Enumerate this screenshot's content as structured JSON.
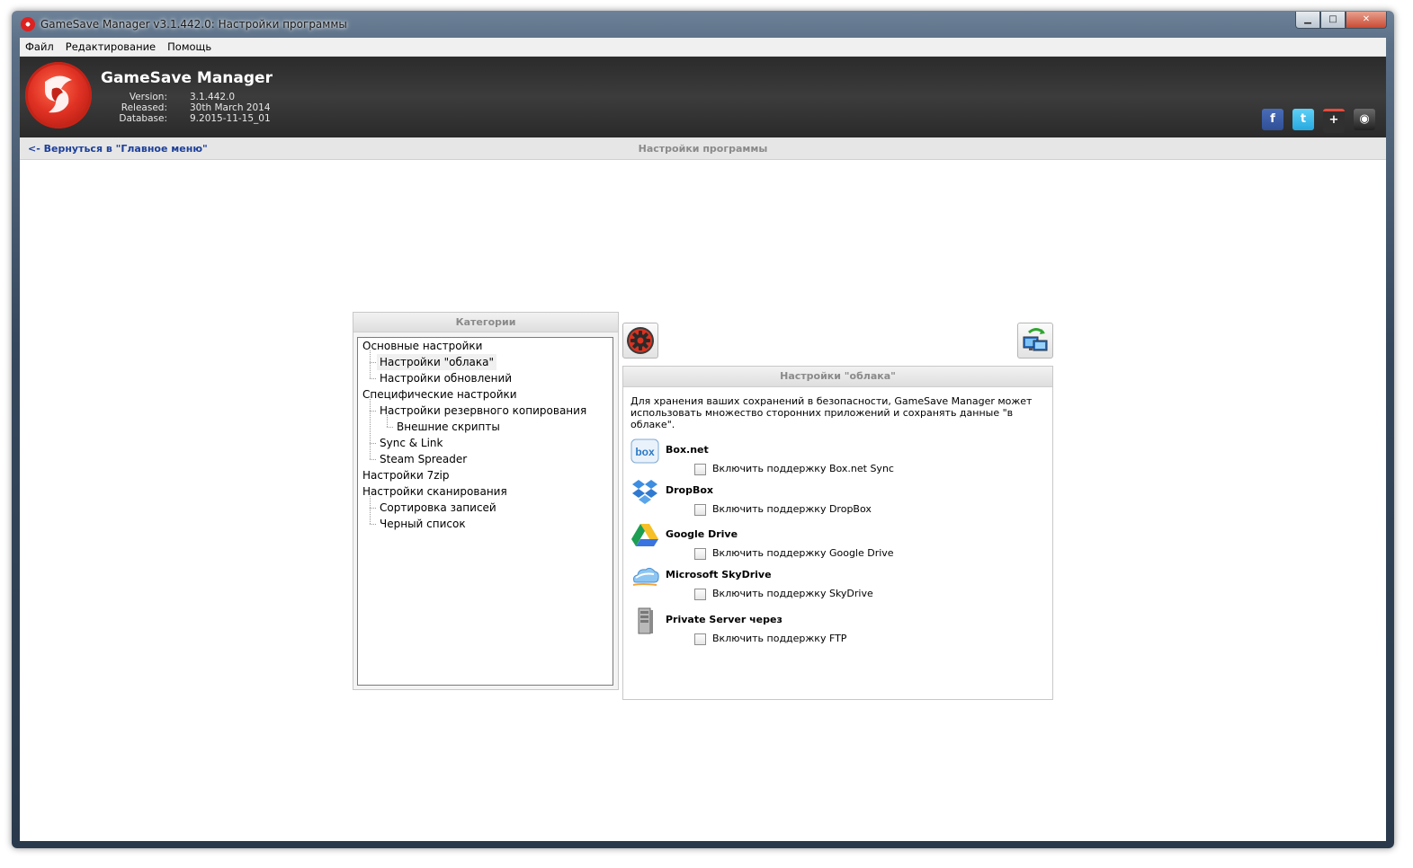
{
  "window": {
    "title": "GameSave Manager v3.1.442.0: Настройки программы",
    "minimize": "▁",
    "maximize": "□",
    "close": "✕"
  },
  "menu": [
    "Файл",
    "Редактирование",
    "Помощь"
  ],
  "header": {
    "app_name": "GameSave Manager",
    "info_labels": [
      "Version:",
      "Released:",
      "Database:"
    ],
    "info_values": [
      "3.1.442.0",
      "30th March 2014",
      "9.2015-11-15_01"
    ],
    "social": {
      "facebook": "f",
      "twitter": "t",
      "google_plus": "+",
      "steam": "◉"
    }
  },
  "nav": {
    "back_link": "<- Вернуться в \"Главное меню\"",
    "page_title": "Настройки программы"
  },
  "categories": {
    "header": "Категории",
    "items": [
      {
        "label": "Основные настройки",
        "level": 0
      },
      {
        "label": "Настройки \"облака\"",
        "level": 1,
        "selected": true
      },
      {
        "label": "Настройки обновлений",
        "level": 1
      },
      {
        "label": "Специфические настройки",
        "level": 0
      },
      {
        "label": "Настройки резервного копирования",
        "level": 1
      },
      {
        "label": "Внешние скрипты",
        "level": 2
      },
      {
        "label": "Sync & Link",
        "level": 1
      },
      {
        "label": "Steam Spreader",
        "level": 1
      },
      {
        "label": "Настройки 7zip",
        "level": 0
      },
      {
        "label": "Настройки сканирования",
        "level": 0
      },
      {
        "label": "Сортировка записей",
        "level": 1
      },
      {
        "label": "Черный список",
        "level": 1
      }
    ]
  },
  "cloud": {
    "header": "Настройки \"облака\"",
    "description": "Для хранения ваших сохранений в безопасности, GameSave Manager может использовать множество сторонних приложений и сохранять данные \"в облаке\".",
    "services": [
      {
        "name": "Box.net",
        "checkbox_label": "Включить поддержку Box.net Sync",
        "checked": false,
        "icon": "box-icon"
      },
      {
        "name": "DropBox",
        "checkbox_label": "Включить поддержку DropBox",
        "checked": false,
        "icon": "dropbox-icon"
      },
      {
        "name": "Google Drive",
        "checkbox_label": "Включить поддержку Google Drive",
        "checked": false,
        "icon": "google-drive-icon"
      },
      {
        "name": "Microsoft SkyDrive",
        "checkbox_label": "Включить поддержку SkyDrive",
        "checked": false,
        "icon": "skydrive-icon"
      },
      {
        "name": "Private Server через",
        "checkbox_label": "Включить поддержку FTP",
        "checked": false,
        "icon": "server-icon"
      }
    ]
  },
  "colors": {
    "link": "#1c3f99",
    "header_bg": "#2b2b2b",
    "logo_red": "#e03224"
  }
}
